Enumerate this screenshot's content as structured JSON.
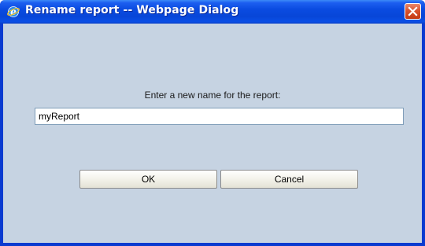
{
  "window": {
    "title": "Rename report -- Webpage Dialog",
    "title_icon": "ie-icon",
    "close_icon": "close-icon"
  },
  "dialog": {
    "prompt": "Enter a new name for the report:",
    "input_value": "myReport",
    "ok_label": "OK",
    "cancel_label": "Cancel"
  },
  "colors": {
    "titlebar": "#0a4be0",
    "frame": "#0a3bd0",
    "background": "#c6d3e2",
    "close_button": "#d8532e"
  }
}
